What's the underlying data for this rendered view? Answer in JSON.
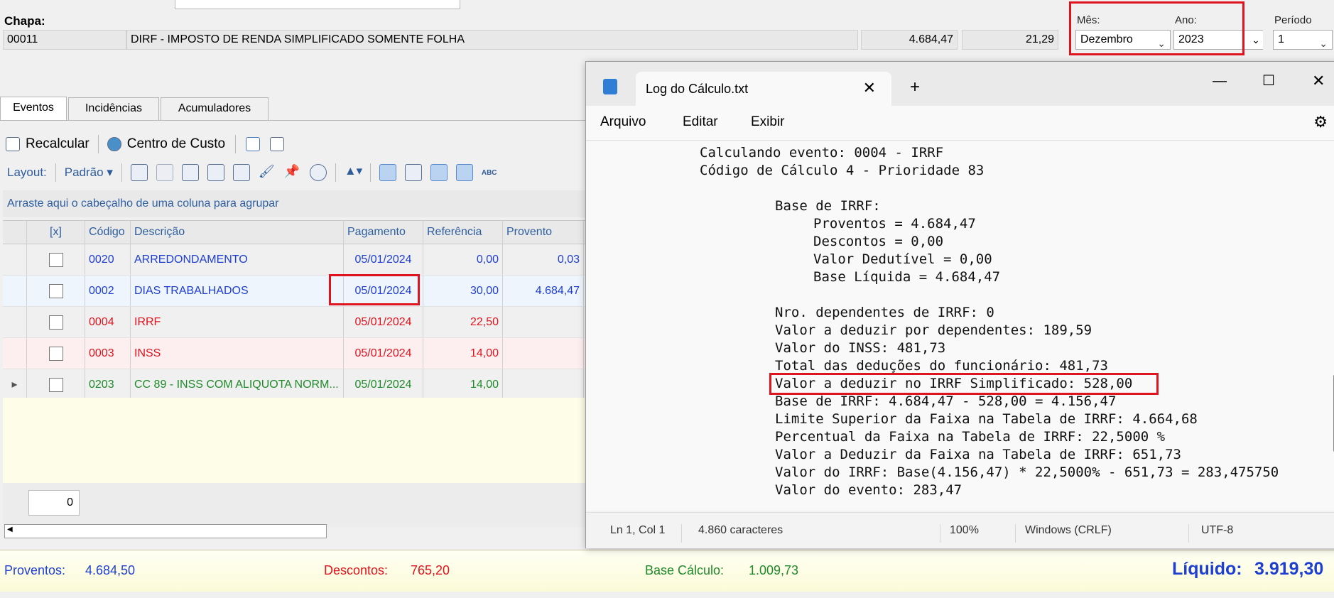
{
  "header": {
    "chapa_label": "Chapa:",
    "chapa_value": "00011",
    "description": "DIRF - IMPOSTO DE RENDA SIMPLIFICADO SOMENTE FOLHA",
    "value1": "4.684,47",
    "value2": "21,29",
    "mes_label": "Mês:",
    "mes_value": "Dezembro",
    "ano_label": "Ano:",
    "ano_value": "2023",
    "periodo_label": "Período",
    "periodo_value": "1"
  },
  "tabs": [
    {
      "label": "Eventos"
    },
    {
      "label": "Incidências"
    },
    {
      "label": "Acumuladores"
    }
  ],
  "toolbar": {
    "recalcular": "Recalcular",
    "centro_custo": "Centro de Custo",
    "layout_label": "Layout:",
    "layout_value": "Padrão"
  },
  "group_hint": "Arraste aqui o cabeçalho de uma coluna para agrupar",
  "grid": {
    "columns": [
      "[x]",
      "Código",
      "Descrição",
      "Pagamento",
      "Referência",
      "Provento"
    ],
    "rows": [
      {
        "codigo": "0020",
        "descricao": "ARREDONDAMENTO",
        "pagamento": "05/01/2024",
        "referencia": "0,00",
        "provento": "0,03",
        "color": "#1f3fd1",
        "bg": "#f0f0f0"
      },
      {
        "codigo": "0002",
        "descricao": "DIAS TRABALHADOS",
        "pagamento": "05/01/2024",
        "referencia": "30,00",
        "provento": "4.684,47",
        "color": "#1f3fd1",
        "bg": "#eef5fd"
      },
      {
        "codigo": "0004",
        "descricao": "IRRF",
        "pagamento": "05/01/2024",
        "referencia": "22,50",
        "provento": "",
        "color": "#e0141e",
        "bg": "#f0f0f0"
      },
      {
        "codigo": "0003",
        "descricao": "INSS",
        "pagamento": "05/01/2024",
        "referencia": "14,00",
        "provento": "",
        "color": "#e0141e",
        "bg": "#fdeef0"
      },
      {
        "codigo": "0203",
        "descricao": "CC 89 - INSS COM ALIQUOTA NORM...",
        "pagamento": "05/01/2024",
        "referencia": "14,00",
        "provento": "",
        "color": "#1f8a2a",
        "bg": "#f0f0f0"
      }
    ],
    "count": "0"
  },
  "footer": {
    "proventos_label": "Proventos:",
    "proventos_value": "4.684,50",
    "descontos_label": "Descontos:",
    "descontos_value": "765,20",
    "base_label": "Base Cálculo:",
    "base_value": "1.009,73",
    "liquido_label": "Líquido:",
    "liquido_value": "3.919,30"
  },
  "notepad": {
    "tab_title": "Log do Cálculo.txt",
    "menu": [
      "Arquivo",
      "Editar",
      "Exibir"
    ],
    "lines": [
      "Calculando evento: 0004 - IRRF",
      "Código de Cálculo 4 - Prioridade 83",
      "",
      "Base de IRRF:",
      "Proventos = 4.684,47",
      "Descontos = 0,00",
      "Valor Dedutível = 0,00",
      "Base Líquida = 4.684,47",
      "",
      "Nro. dependentes de IRRF: 0",
      "Valor a deduzir por dependentes: 189,59",
      "Valor do INSS: 481,73",
      "Total das deduções do funcionário: 481,73",
      "Valor a deduzir no IRRF Simplificado: 528,00",
      "Base de IRRF: 4.684,47 - 528,00 = 4.156,47",
      "Limite Superior da Faixa na Tabela de IRRF: 4.664,68",
      "Percentual da Faixa na Tabela de IRRF: 22,5000 %",
      "Valor a Deduzir da Faixa na Tabela de IRRF: 651,73",
      "Valor do IRRF: Base(4.156,47) * 22,5000% - 651,73 = 283,475750",
      "Valor do evento: 283,47"
    ],
    "status": {
      "position": "Ln 1, Col 1",
      "chars": "4.860 caracteres",
      "zoom": "100%",
      "eol": "Windows (CRLF)",
      "encoding": "UTF-8"
    }
  }
}
